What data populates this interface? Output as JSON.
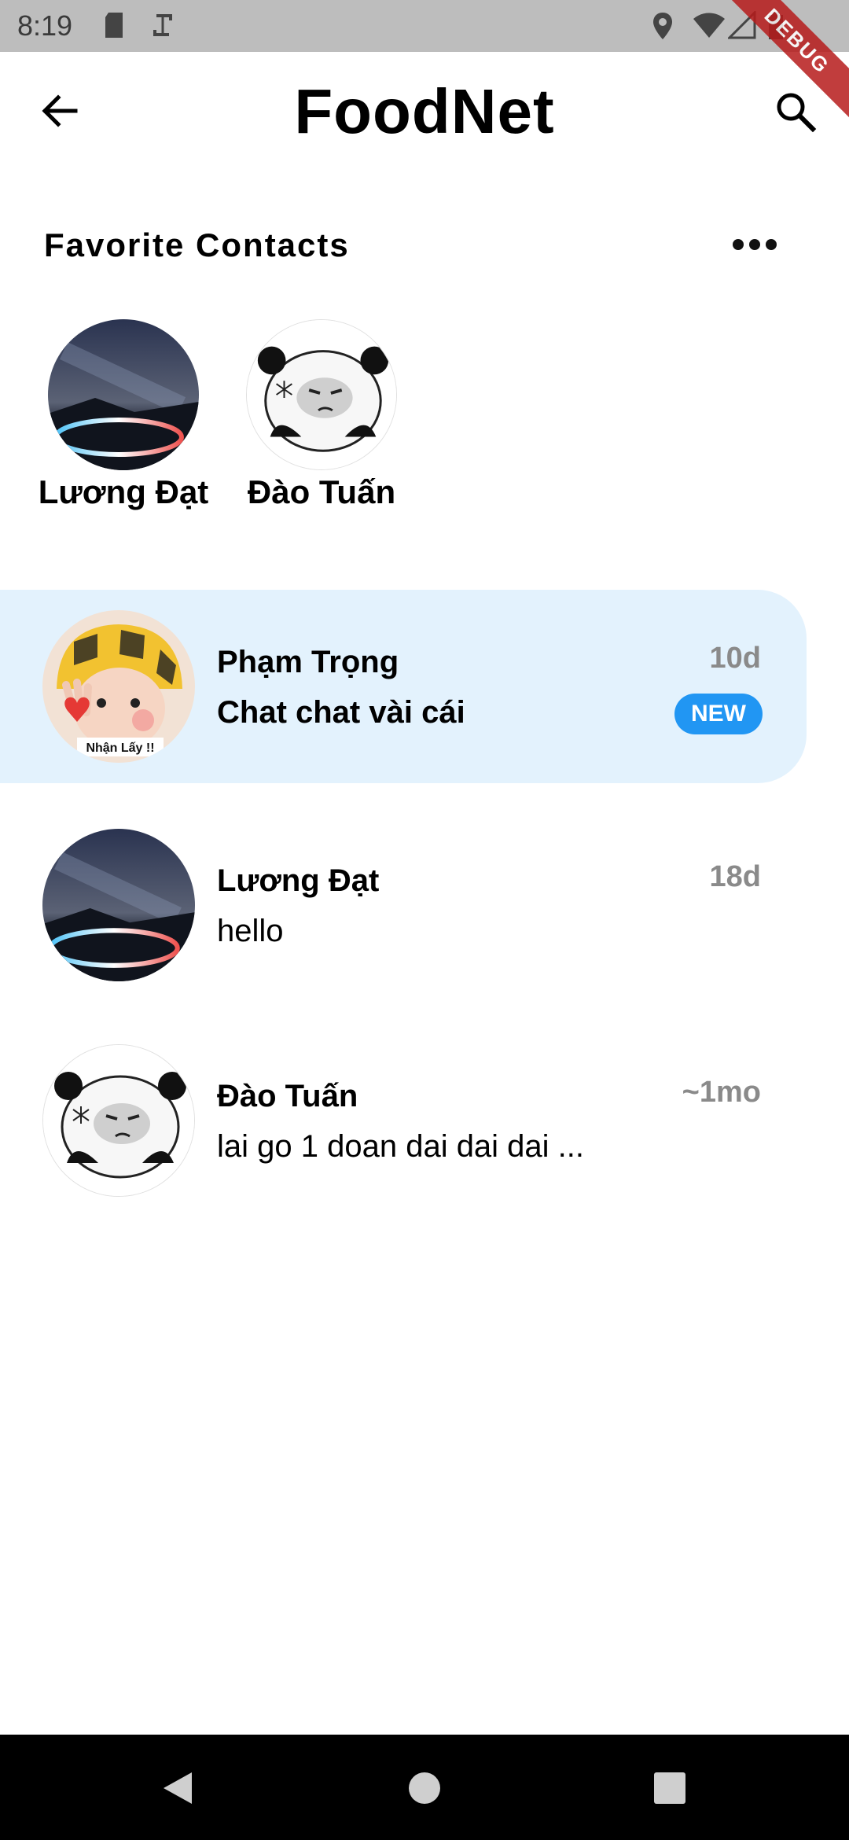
{
  "status_bar": {
    "time": "8:19",
    "debug_label": "DEBUG"
  },
  "app_bar": {
    "title": "FoodNet"
  },
  "favorites": {
    "header": "Favorite Contacts",
    "contacts": [
      {
        "name": "Lương Đạt",
        "avatar": "night-sky-avatar"
      },
      {
        "name": "Đào Tuấn",
        "avatar": "panda-meme-avatar"
      }
    ]
  },
  "chats": [
    {
      "name": "Phạm Trọng",
      "message": "Chat chat vài cái",
      "time": "10d",
      "badge": "NEW",
      "unread": true,
      "avatar": "helmet-kid-avatar",
      "avatar_caption": "Nhận Lấy !!"
    },
    {
      "name": "Lương Đạt",
      "message": "hello",
      "time": "18d",
      "unread": false,
      "avatar": "night-sky-avatar"
    },
    {
      "name": "Đào Tuấn",
      "message": "lai go 1 doan dai dai dai ...",
      "time": "~1mo",
      "unread": false,
      "avatar": "panda-meme-avatar"
    }
  ],
  "colors": {
    "accent": "#2196f3",
    "highlight_bg": "#e3f2fd",
    "time_gray": "#8a8a8a"
  }
}
